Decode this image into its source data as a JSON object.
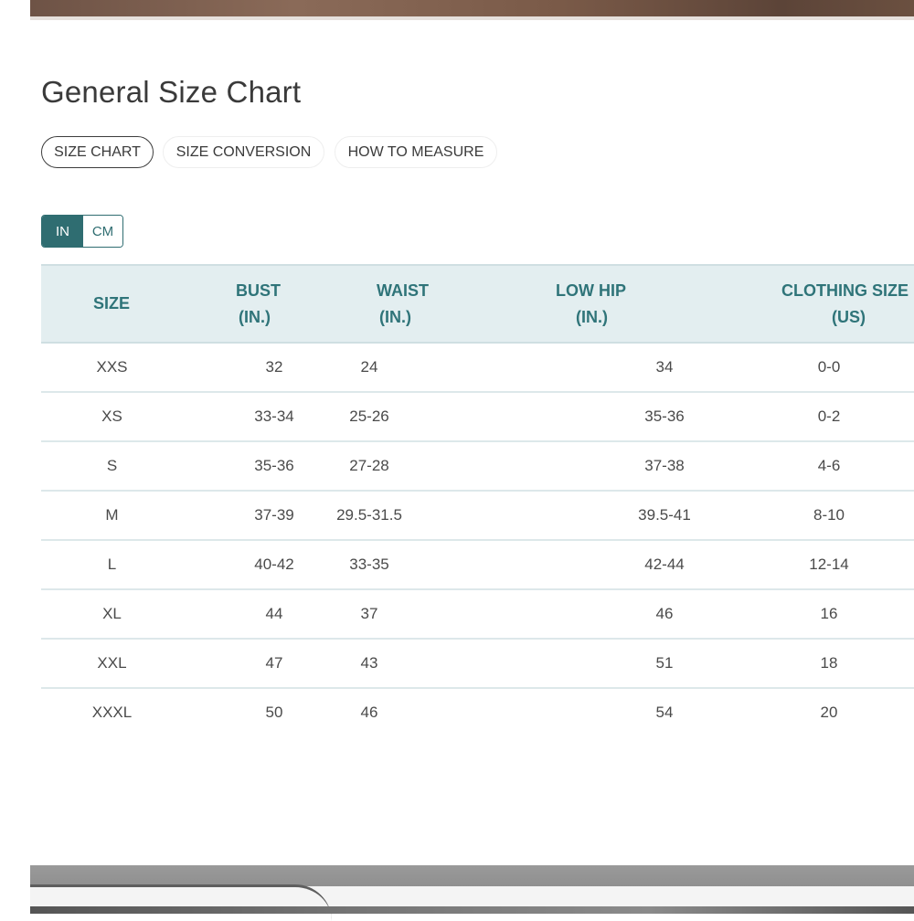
{
  "page_title": "General Size Chart",
  "tabs": [
    {
      "label": "SIZE CHART",
      "active": true
    },
    {
      "label": "SIZE CONVERSION",
      "active": false
    },
    {
      "label": "HOW TO MEASURE",
      "active": false
    }
  ],
  "unit_toggle": {
    "options": [
      "IN",
      "CM"
    ],
    "selected": "IN"
  },
  "table": {
    "headers": [
      {
        "line1": "SIZE",
        "line2": ""
      },
      {
        "line1": "BUST",
        "line2": "(IN.)"
      },
      {
        "line1": "WAIST",
        "line2": "(IN.)"
      },
      {
        "line1": "LOW HIP",
        "line2": "(IN.)"
      },
      {
        "line1": "CLOTHING SIZE",
        "line2": "(US)"
      }
    ],
    "rows": [
      [
        "XXS",
        "32",
        "24",
        "34",
        "0-0"
      ],
      [
        "XS",
        "33-34",
        "25-26",
        "35-36",
        "0-2"
      ],
      [
        "S",
        "35-36",
        "27-28",
        "37-38",
        "4-6"
      ],
      [
        "M",
        "37-39",
        "29.5-31.5",
        "39.5-41",
        "8-10"
      ],
      [
        "L",
        "40-42",
        "33-35",
        "42-44",
        "12-14"
      ],
      [
        "XL",
        "44",
        "37",
        "46",
        "16"
      ],
      [
        "XXL",
        "47",
        "43",
        "51",
        "18"
      ],
      [
        "XXXL",
        "50",
        "46",
        "54",
        "20"
      ]
    ]
  },
  "colors": {
    "accent": "#2f6d71",
    "header_bg": "#e3eef0",
    "header_text": "#2f7479",
    "body_text": "#4a4a4a"
  }
}
